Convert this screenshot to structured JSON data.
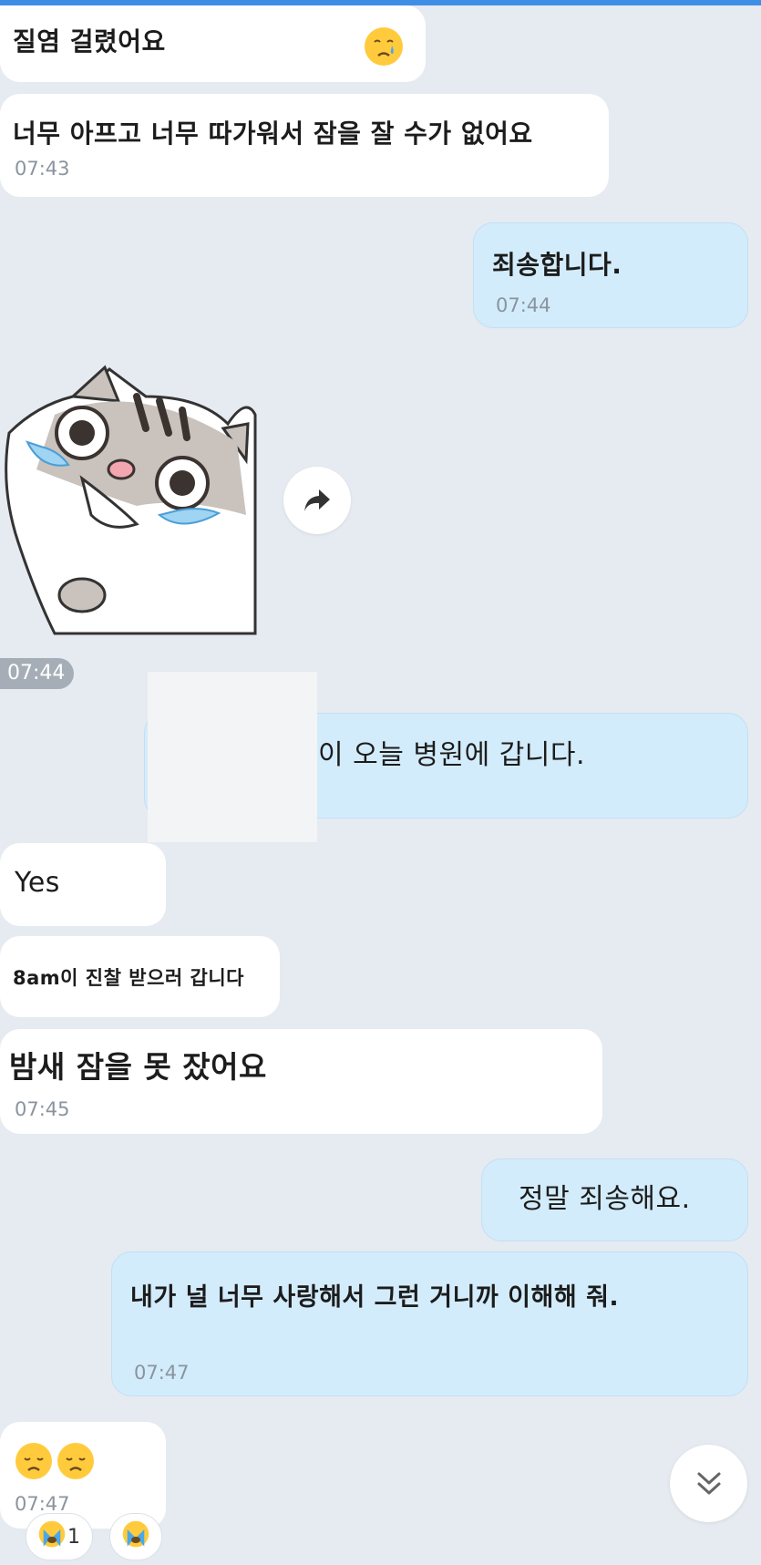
{
  "messages": [
    {
      "text": "질염 걸렸어요"
    },
    {
      "text": "너무 아프고 너무 따가워서 잠을 잘 수가 없어요",
      "time": "07:43"
    },
    {
      "text": "죄송합니다.",
      "time": "07:44"
    },
    {
      "text": "이 오늘 병원에 갑니다."
    },
    {
      "text": "Yes"
    },
    {
      "text": "8am이 진찰 받으러 갑니다"
    },
    {
      "text": "밤새 잠을 못 잤어요",
      "time": "07:45"
    },
    {
      "text": "정말 죄송해요."
    },
    {
      "text": "내가 널 너무 사랑해서 그런 거니까 이해해 줘.",
      "time": "07:47"
    },
    {
      "time": "07:47"
    }
  ],
  "sticker": {
    "name": "crying-cat-sticker",
    "time": "07:44"
  },
  "reactions": [
    {
      "icon": "loudly-crying-face-icon",
      "count": "1"
    },
    {
      "icon": "loudly-crying-face-icon",
      "count": ""
    }
  ],
  "colors": {
    "incoming": "#ffffff",
    "outgoing": "#d3ecfb",
    "background": "#e6eaf1",
    "accent": "#3f8ee6"
  }
}
